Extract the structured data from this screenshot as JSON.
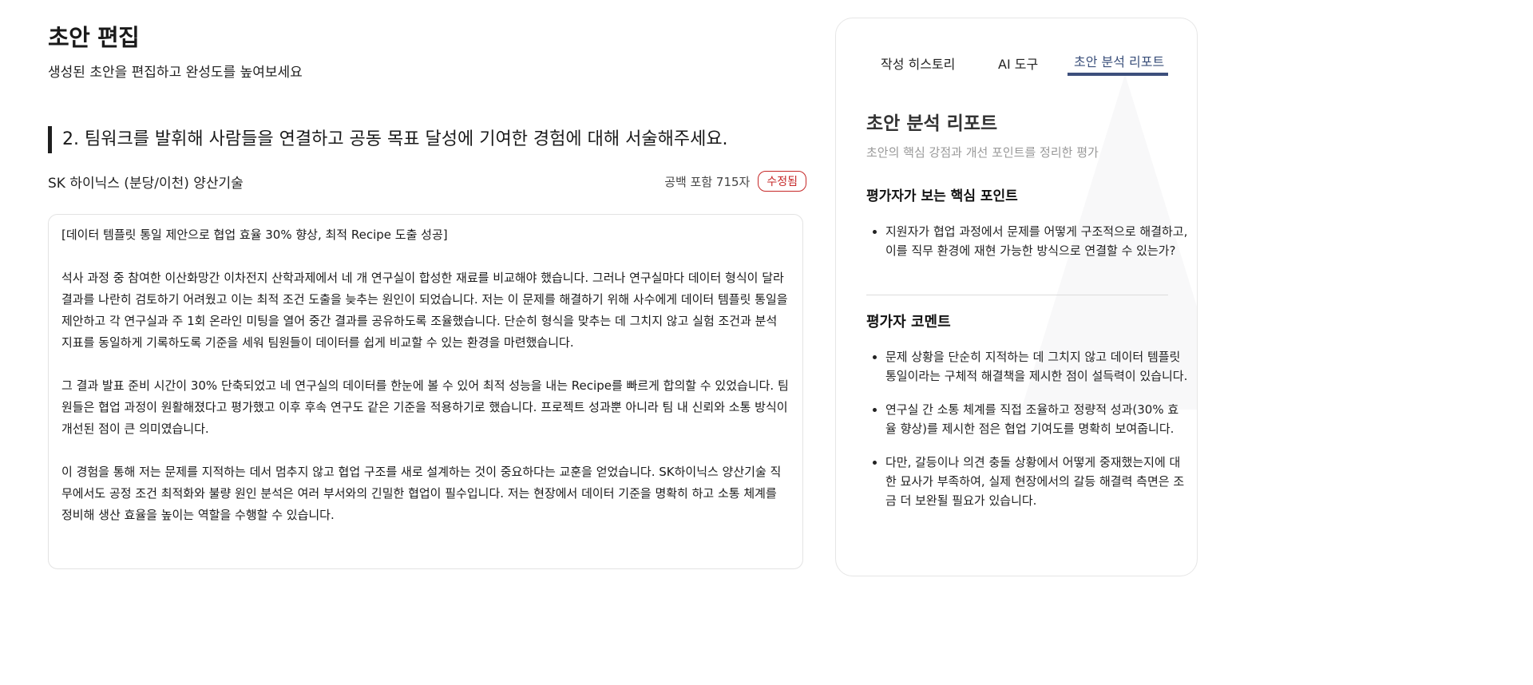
{
  "page": {
    "title": "초안 편집",
    "subtitle": "생성된 초안을 편집하고 완성도를 높여보세요"
  },
  "question": {
    "text": "2. 팀워크를 발휘해 사람들을 연결하고 공동 목표 달성에 기여한 경험에 대해 서술해주세요.",
    "company": "SK 하이닉스 (분당/이천) 양산기술",
    "char_count": "공백 포함 715자",
    "status": "수정됨"
  },
  "editor": {
    "heading": "[데이터 템플릿 통일 제안으로 협업 효율 30% 향상, 최적 Recipe 도출 성공]",
    "paragraphs": [
      "석사 과정 중 참여한 이산화망간 이차전지 산학과제에서 네 개 연구실이 합성한 재료를 비교해야 했습니다. 그러나 연구실마다 데이터 형식이 달라 결과를 나란히 검토하기 어려웠고 이는 최적 조건 도출을 늦추는 원인이 되었습니다. 저는 이 문제를 해결하기 위해 사수에게 데이터 템플릿 통일을 제안하고 각 연구실과 주 1회 온라인 미팅을 열어 중간 결과를 공유하도록 조율했습니다. 단순히 형식을 맞추는 데 그치지 않고 실험 조건과 분석 지표를 동일하게 기록하도록 기준을 세워 팀원들이 데이터를 쉽게 비교할 수 있는 환경을 마련했습니다.",
      "그 결과 발표 준비 시간이 30% 단축되었고 네 연구실의 데이터를 한눈에 볼 수 있어 최적 성능을 내는 Recipe를 빠르게 합의할 수 있었습니다. 팀원들은 협업 과정이 원활해졌다고 평가했고 이후 후속 연구도 같은 기준을 적용하기로 했습니다. 프로젝트 성과뿐 아니라 팀 내 신뢰와 소통 방식이 개선된 점이 큰 의미였습니다.",
      "이 경험을 통해 저는 문제를 지적하는 데서 멈추지 않고 협업 구조를 새로 설계하는 것이 중요하다는 교훈을 얻었습니다. SK하이닉스 양산기술 직무에서도 공정 조건 최적화와 불량 원인 분석은 여러 부서와의 긴밀한 협업이 필수입니다. 저는 현장에서 데이터 기준을 명확히 하고 소통 체계를 정비해 생산 효율을 높이는 역할을 수행할 수 있습니다."
    ]
  },
  "panel": {
    "tabs": [
      "작성 히스토리",
      "AI 도구",
      "초안 분석 리포트"
    ],
    "active_tab": "초안 분석 리포트",
    "report_title": "초안 분석 리포트",
    "report_subtitle": "초안의 핵심 강점과 개선 포인트를 정리한 평가",
    "key_points_heading": "평가자가 보는 핵심 포인트",
    "key_points": [
      "지원자가 협업 과정에서 문제를 어떻게 구조적으로 해결하고, 이를 직무 환경에 재현 가능한 방식으로 연결할 수 있는가?"
    ],
    "comment_heading": "평가자 코멘트",
    "comments": [
      "문제 상황을 단순히 지적하는 데 그치지 않고 데이터 템플릿 통일이라는 구체적 해결책을 제시한 점이 설득력이 있습니다.",
      "연구실 간 소통 체계를 직접 조율하고 정량적 성과(30% 효율 향상)를 제시한 점은 협업 기여도를 명확히 보여줍니다.",
      "다만, 갈등이나 의견 충돌 상황에서 어떻게 중재했는지에 대한 묘사가 부족하여, 실제 현장에서의 갈등 해결력 측면은 조금 더 보완될 필요가 있습니다."
    ]
  },
  "colors": {
    "accent": "#3d4f7c",
    "badge": "#c62828"
  }
}
